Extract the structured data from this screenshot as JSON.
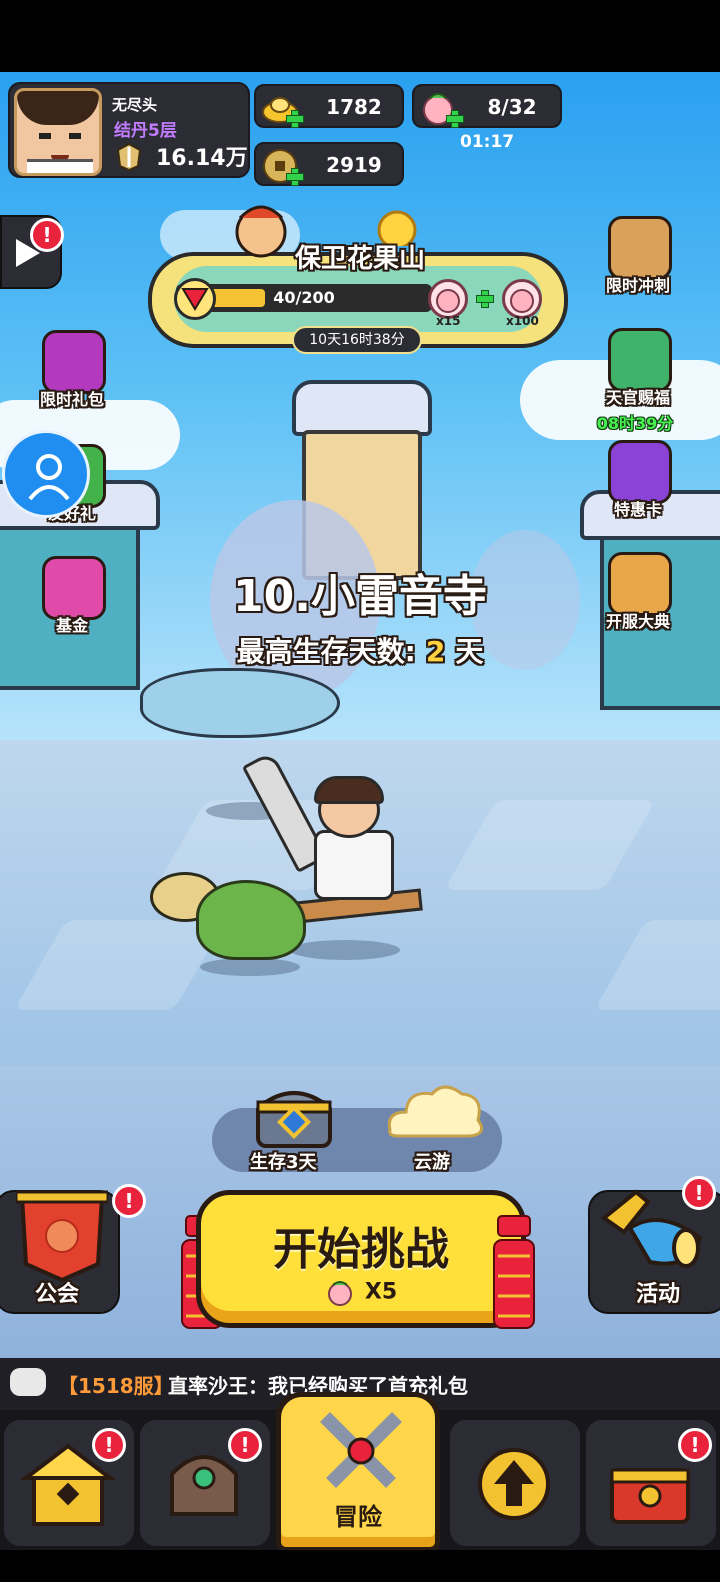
{
  "player": {
    "name": "无尽头",
    "rank": "结丹5层",
    "power": "16.14万"
  },
  "currencies": {
    "gold_ingot": "1782",
    "stamina": "8/32",
    "stamina_timer": "01:17",
    "coins": "2919"
  },
  "event": {
    "title": "保卫花果山",
    "progress_text": "40/200",
    "progress_fraction": 0.2,
    "reward_small": "x15",
    "reward_large": "x100",
    "countdown": "10天16时38分"
  },
  "left_menu": [
    {
      "label": "限时礼包",
      "icon": "gift-bag-icon"
    },
    {
      "label": "友好礼",
      "icon": "friend-gift-icon"
    },
    {
      "label": "基金",
      "icon": "fund-icon"
    }
  ],
  "right_menu": [
    {
      "label": "限时冲刺",
      "icon": "hourglass-icon"
    },
    {
      "label": "天官赐福",
      "icon": "fan-icon",
      "timer": "08时39分"
    },
    {
      "label": "特惠卡",
      "icon": "vip-card-icon"
    },
    {
      "label": "开服大典",
      "icon": "drum-icon"
    }
  ],
  "stage": {
    "title": "10.小雷音寺",
    "best_label": "最高生存天数:",
    "best_value": "2",
    "best_unit": "天"
  },
  "rewards": {
    "chest_label": "生存3天",
    "cloud_label": "云游"
  },
  "buttons": {
    "guild": "公会",
    "activity": "活动",
    "start": "开始挑战",
    "start_cost": "X5"
  },
  "chat": {
    "server": "【1518服】",
    "message": "直率沙王：我已经购买了首充礼包"
  },
  "nav": {
    "active_label": "冒险"
  },
  "colors": {
    "accent_yellow": "#ffd64a",
    "badge_red": "#e8233b",
    "rank_purple": "#c27cff",
    "timer_green": "#48f050"
  }
}
